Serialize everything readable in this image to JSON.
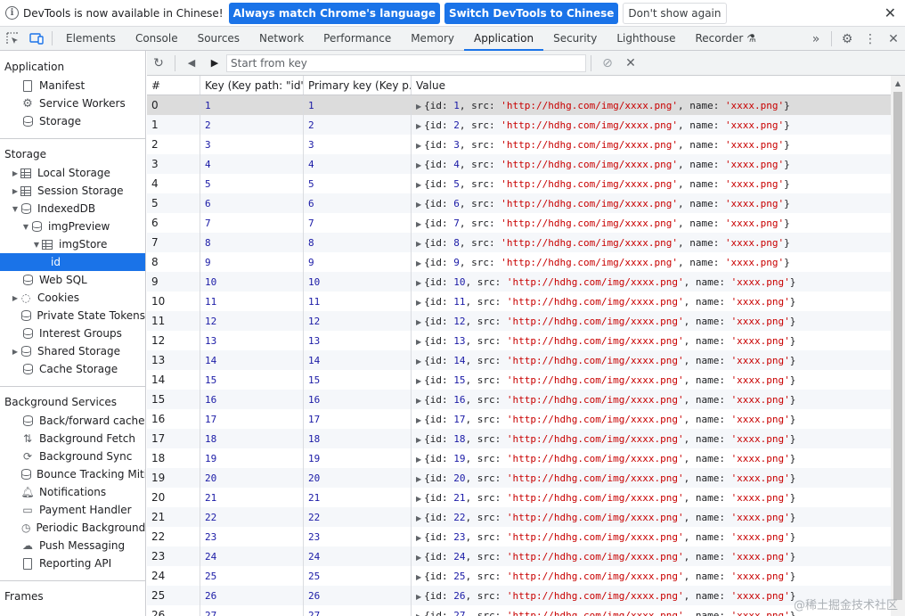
{
  "infobar": {
    "message": "DevTools is now available in Chinese!",
    "btn_match": "Always match Chrome's language",
    "btn_switch": "Switch DevTools to Chinese",
    "btn_dont_show": "Don't show again",
    "close_icon": "close-icon"
  },
  "tabs": [
    "Elements",
    "Console",
    "Sources",
    "Network",
    "Performance",
    "Memory",
    "Application",
    "Security",
    "Lighthouse",
    "Recorder"
  ],
  "active_tab": "Application",
  "sidebar": {
    "application_title": "Application",
    "application_items": [
      "Manifest",
      "Service Workers",
      "Storage"
    ],
    "storage_title": "Storage",
    "storage_items": {
      "local": "Local Storage",
      "session": "Session Storage",
      "indexeddb": "IndexedDB",
      "db": "imgPreview",
      "store": "imgStore",
      "index": "id",
      "websql": "Web SQL",
      "cookies": "Cookies",
      "private": "Private State Tokens",
      "interest": "Interest Groups",
      "shared": "Shared Storage",
      "cache": "Cache Storage"
    },
    "bg_title": "Background Services",
    "bg_items": [
      "Back/forward cache",
      "Background Fetch",
      "Background Sync",
      "Bounce Tracking Mitig",
      "Notifications",
      "Payment Handler",
      "Periodic Background S",
      "Push Messaging",
      "Reporting API"
    ],
    "frames_title": "Frames"
  },
  "content_toolbar": {
    "start_placeholder": "Start from key"
  },
  "table": {
    "headers": [
      "#",
      "Key (Key path: \"id\")",
      "Primary key (Key p...",
      "Value"
    ],
    "url": "http://hdhg.com/img/xxxx.png",
    "name": "xxxx.png",
    "row_count": 27
  },
  "watermark": "@稀土掘金技术社区"
}
